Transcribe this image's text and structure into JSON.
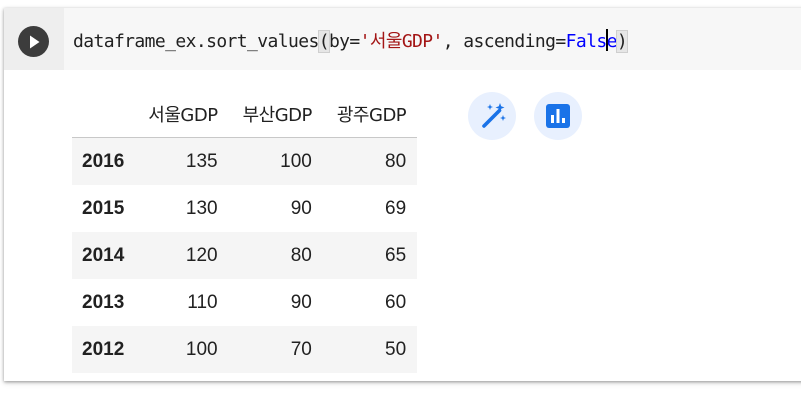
{
  "cell": {
    "code": {
      "prefix": "dataframe_ex.sort_values",
      "open_paren": "(",
      "by_kw": "by=",
      "by_value": "'서울GDP'",
      "mid": ", ascending=",
      "bool_value": "Fals",
      "bool_tail": "e",
      "close_paren": ")"
    },
    "run_icon": "play-icon"
  },
  "output": {
    "table": {
      "columns": [
        "서울GDP",
        "부산GDP",
        "광주GDP"
      ],
      "rows": [
        {
          "index": "2016",
          "values": [
            "135",
            "100",
            "80"
          ]
        },
        {
          "index": "2015",
          "values": [
            "130",
            "90",
            "69"
          ]
        },
        {
          "index": "2014",
          "values": [
            "120",
            "80",
            "65"
          ]
        },
        {
          "index": "2013",
          "values": [
            "110",
            "90",
            "60"
          ]
        },
        {
          "index": "2012",
          "values": [
            "100",
            "70",
            "50"
          ]
        }
      ]
    },
    "buttons": [
      {
        "icon": "magic-wand-icon"
      },
      {
        "icon": "bar-chart-icon"
      }
    ],
    "accent_color": "#1a73e8"
  }
}
